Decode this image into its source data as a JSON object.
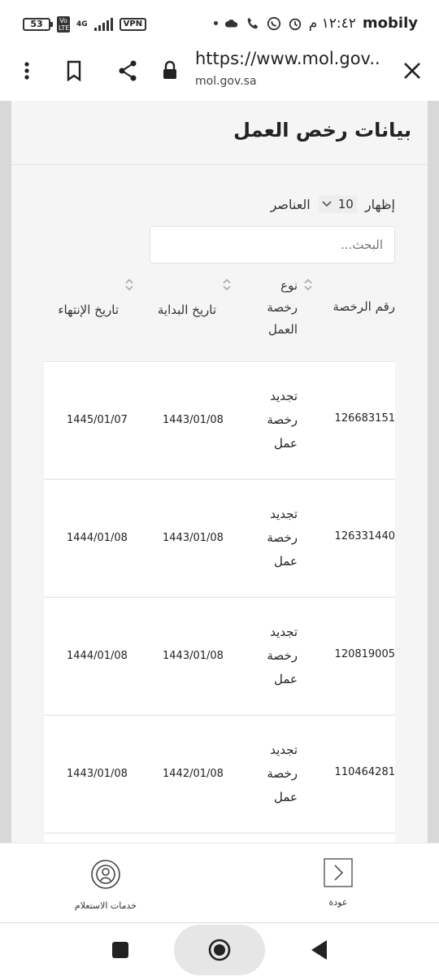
{
  "status_bar": {
    "carrier": "mobily",
    "time": "١٢:٤٢ م",
    "battery": "53",
    "volte_label": "Vo LTE",
    "network": "4G",
    "vpn_label": "VPN"
  },
  "browser": {
    "url": "https://www.mol.gov....",
    "domain": "mol.gov.sa"
  },
  "page": {
    "title": "بيانات رخص العمل",
    "show_label": "إظهار",
    "page_size": "10",
    "items_label": "العناصر",
    "search_placeholder": "البحث..."
  },
  "table": {
    "headers": {
      "license_number": "رقم الرخصة",
      "license_type": "نوع رخصة العمل",
      "start_date": "تاريخ البداية",
      "end_date": "تاريخ الإنتهاء"
    },
    "rows": [
      {
        "number": "126683151",
        "type": "تجديد رخصة عمل",
        "start": "1443/01/08",
        "end": "1445/01/07"
      },
      {
        "number": "126331440",
        "type": "تجديد رخصة عمل",
        "start": "1443/01/08",
        "end": "1444/01/08"
      },
      {
        "number": "120819005",
        "type": "تجديد رخصة عمل",
        "start": "1443/01/08",
        "end": "1444/01/08"
      },
      {
        "number": "110464281",
        "type": "تجديد رخصة عمل",
        "start": "1442/01/08",
        "end": "1443/01/08"
      }
    ]
  },
  "bottom_nav": {
    "back_label": "عودة",
    "inquiry_label": "خدمات الاستعلام"
  },
  "colors": {
    "page_bg": "#d8d8d8",
    "card_bg": "#f5f5f5",
    "row_bg": "#ffffff",
    "text": "#222222"
  }
}
